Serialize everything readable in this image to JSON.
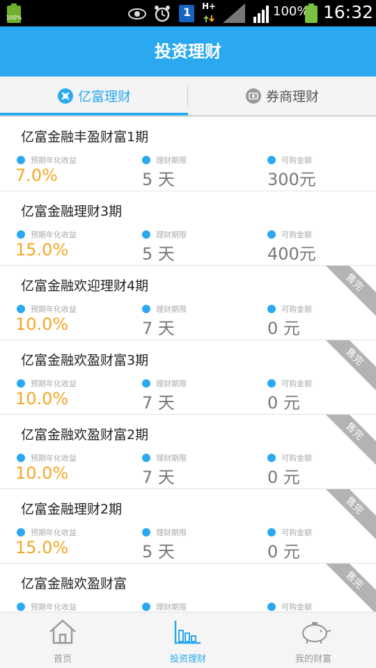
{
  "status_bar": {
    "battery_left_label": "100%",
    "battery_percent": "100%",
    "time": "16:32",
    "sim_label": "1",
    "network_label": "H+"
  },
  "header": {
    "title": "投资理财"
  },
  "tabs": [
    {
      "label": "亿富理财",
      "icon": "yifu-icon",
      "active": true
    },
    {
      "label": "券商理财",
      "icon": "broker-icon",
      "active": false
    }
  ],
  "labels": {
    "rate": "预期年化收益",
    "period": "理财期限",
    "amount": "可购金额",
    "soldout": "售完"
  },
  "products": [
    {
      "name": "亿富金融丰盈财富1期",
      "rate": "7.0%",
      "period": "5 天",
      "amount": "300元",
      "sold_out": false
    },
    {
      "name": "亿富金融理财3期",
      "rate": "15.0%",
      "period": "5 天",
      "amount": "400元",
      "sold_out": false
    },
    {
      "name": "亿富金融欢迎理财4期",
      "rate": "10.0%",
      "period": "7 天",
      "amount": "0 元",
      "sold_out": true
    },
    {
      "name": "亿富金融欢盈财富3期",
      "rate": "10.0%",
      "period": "7 天",
      "amount": "0 元",
      "sold_out": true
    },
    {
      "name": "亿富金融欢盈财富2期",
      "rate": "10.0%",
      "period": "7 天",
      "amount": "0 元",
      "sold_out": true
    },
    {
      "name": "亿富金融理财2期",
      "rate": "15.0%",
      "period": "5 天",
      "amount": "0 元",
      "sold_out": true
    },
    {
      "name": "亿富金融欢盈财富",
      "rate": "",
      "period": "",
      "amount": "",
      "sold_out": true
    }
  ],
  "bottom_nav": [
    {
      "label": "首页",
      "icon": "home-icon",
      "active": false
    },
    {
      "label": "投资理财",
      "icon": "bar-chart-icon",
      "active": true
    },
    {
      "label": "我的财富",
      "icon": "piggy-bank-icon",
      "active": false
    }
  ],
  "colors": {
    "accent": "#2aa8f0",
    "rate": "#f5a623",
    "soldout": "#b3b3b3"
  }
}
